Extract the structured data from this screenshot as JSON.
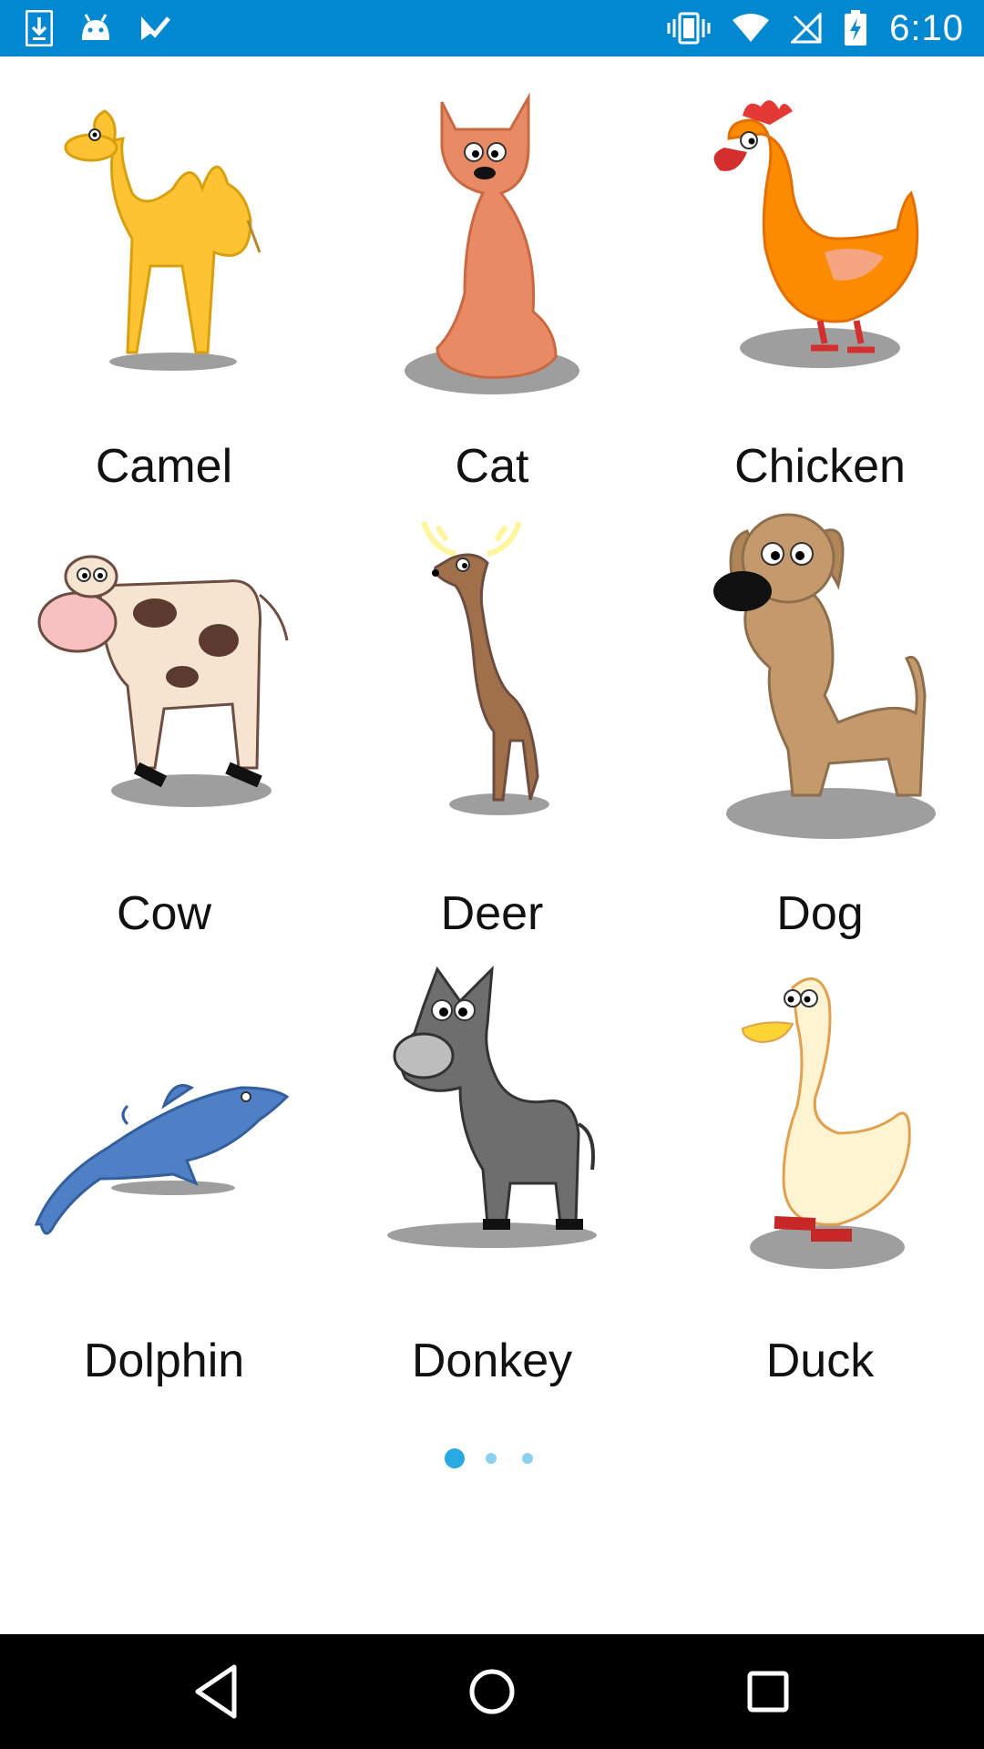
{
  "status_bar": {
    "time": "6:10",
    "left_icons": [
      "download-icon",
      "android-icon",
      "checklist-icon"
    ],
    "right_icons": [
      "vibrate-icon",
      "wifi-icon",
      "no-signal-icon",
      "battery-charging-icon"
    ]
  },
  "animals": [
    {
      "name": "Camel"
    },
    {
      "name": "Cat"
    },
    {
      "name": "Chicken"
    },
    {
      "name": "Cow"
    },
    {
      "name": "Deer"
    },
    {
      "name": "Dog"
    },
    {
      "name": "Dolphin"
    },
    {
      "name": "Donkey"
    },
    {
      "name": "Duck"
    }
  ],
  "pager": {
    "current_page": 1,
    "page_count": 3
  },
  "colors": {
    "status_bar": "#0288d1",
    "accent_dot": "#29a9e1",
    "nav_bar": "#000000"
  }
}
